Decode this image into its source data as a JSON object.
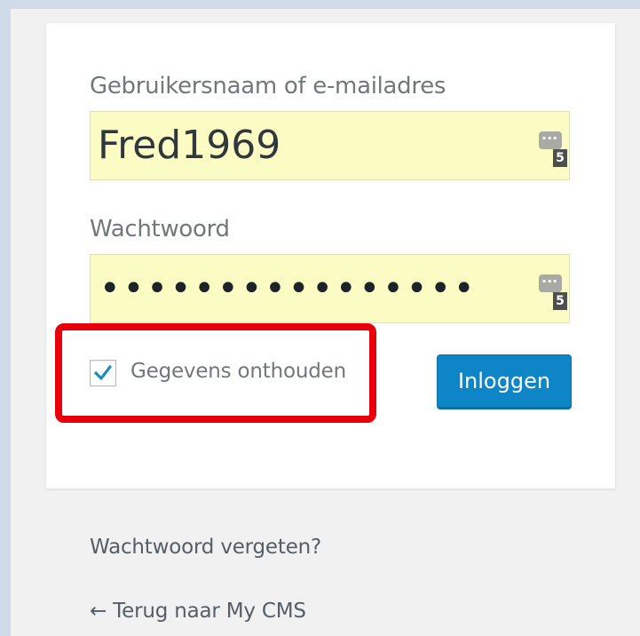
{
  "login_form": {
    "username_label": "Gebruikersnaam of e-mailadres",
    "username_value": "Fred1969",
    "password_label": "Wachtwoord",
    "password_masked": "••••••••••••••••",
    "password_manager_icon": "password-manager-icon",
    "password_manager_count": "5",
    "remember_label": "Gegevens onthouden",
    "remember_checked": true,
    "login_button_label": "Inloggen"
  },
  "links": {
    "forgot_password": "Wachtwoord vergeten?",
    "back_to_site": "← Terug naar My CMS"
  },
  "colors": {
    "page_background": "#f1f1f1",
    "autofill_background": "#fafcc4",
    "primary_button": "#0e85c7",
    "highlight": "#e8000b",
    "checkmark": "#1e8cbe"
  }
}
